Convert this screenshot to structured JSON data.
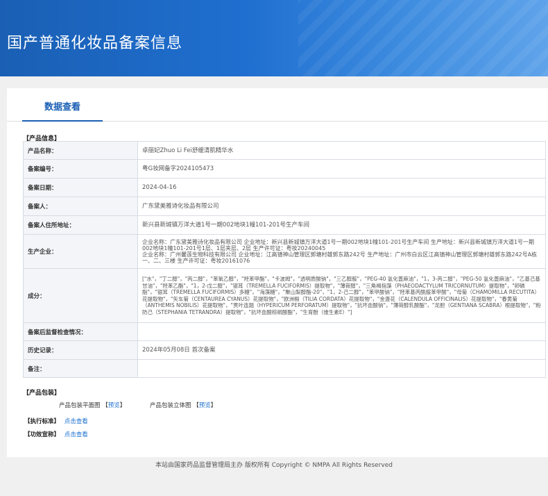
{
  "header": {
    "title": "国产普通化妆品备案信息"
  },
  "tabs": [
    {
      "label": "数据查看"
    }
  ],
  "product_info": {
    "section_label": "【产品信息】",
    "rows": [
      {
        "key": "产品名称：",
        "value": "卓丽妃Zhuo Li Fei舒缓清肌精华水"
      },
      {
        "key": "备案编号：",
        "value": "粤G妆网备字2024105473"
      },
      {
        "key": "备案日期：",
        "value": "2024-04-16"
      },
      {
        "key": "备案人：",
        "value": "广东黛美雅诗化妆品有限公司"
      },
      {
        "key": "备案人住所地址：",
        "value": "新兴县新城镇万洋大道1号一期002地块1幢101-201号生产车间"
      },
      {
        "key": "生产企业：",
        "value": "企业名称：广东黛美雅诗化妆品有限公司 企业地址：新兴县新城镇万洋大道1号一期002地块1幢101-201号生产车间 生产地址：新兴县新城镇万洋大道1号一期002地块1幢101-201号1层、1层夹层、2层 生产许可证：粤妆20240045\n企业名称：广州馨莲生物科技有限公司 企业地址：江高镇神山管理区郭塘村雄郭东路242号 生产地址：广州市白云区江高镇神山管理区郭塘村雄郭东路242号A栋一、二、三楼 生产许可证：粤妆20161076"
      },
      {
        "key": "成分：",
        "value": "[\"水\"，\"丁二醇\"，\"丙二醇\"，\"苯氧乙醇\"，\"羟苯甲酯\"，\"卡波姆\"，\"透明质酸钠\"，\"三乙醇胺\"，\"PEG-40 氢化蓖麻油\"，\"1，3-丙二醇\"，\"PEG-50 氢化蓖麻油\"，\"乙基己基甘油\"，\"羟苯乙酯\"，\"1，2-戊二醇\"，\"银耳（TREMELLA FUCIFORMIS）提取物\"，\"薄荷醇\"，\"三角褐指藻（PHAEODACTYLUM TRICORNUTUM）提取物\"，\"卵磷脂\"，\"银耳（TREMELLA FUCIFORMIS）多糖\"，\"海藻糖\"，\"聚山梨醇酯-20\"，\"1，2-己二醇\"，\"苯甲酸钠\"，\"羟苯基丙酰胺苯甲酸\"，\"母菊（CHAMOMILLA RECUTITA）花提取物\"，\"矢车菊（CENTAUREA CYANUS）花提取物\"，\"欧洲椴（TILIA CORDATA）花提取物\"，\"金盏花（CALENDULA OFFICINALIS）花提取物\"，\"春黄菊（ANTHEMIS NOBILIS）花提取物\"，\"贯叶连翘（HYPERICUM PERFORATUM）提取物\"，\"抗坏血酸钠\"，\"薄荷醇乳酸酯\"，\"龙胆（GENTIANA SCABRA）根提取物\"，\"粉防己（STEPHANIA TETRANDRA）提取物\"，\"抗坏血酸棕榈酸酯\"，\"生育酚（维生素E）\"]"
      },
      {
        "key": "备案后监督检查情况：",
        "value": ""
      },
      {
        "key": "历史记录：",
        "value": "2024年05月08日  首次备案"
      },
      {
        "key": "备注：",
        "value": ""
      }
    ]
  },
  "packaging": {
    "section_label": "【产品包装】",
    "flat_label": "产品包装平面图",
    "flat_link": "预览",
    "solid_label": "产品包装立体图",
    "solid_link": "预览"
  },
  "standard": {
    "label": "【执行标准】",
    "link": "点击查看"
  },
  "efficacy": {
    "label": "【功效宣称】",
    "link": "点击查看"
  },
  "footer": {
    "text": "本站由国家药品监督管理局主办 版权所有 Copyright © NMPA All Rights Reserved"
  }
}
